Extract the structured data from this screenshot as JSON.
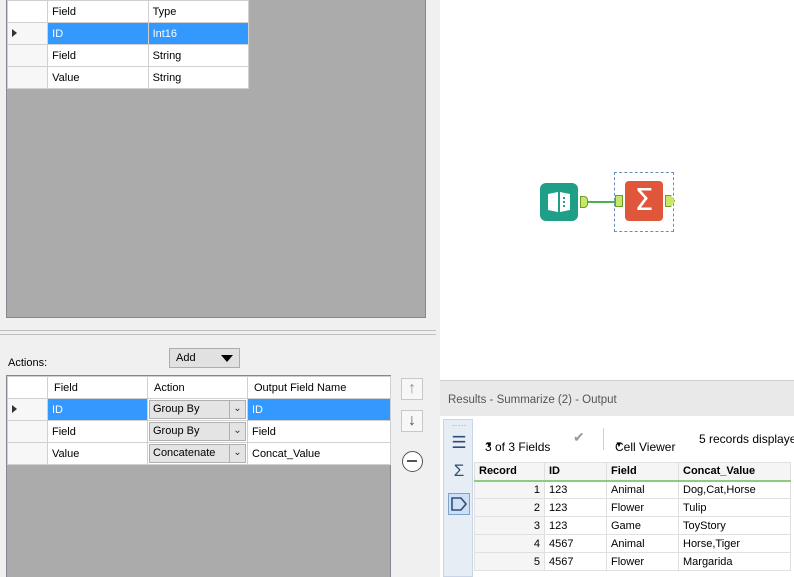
{
  "fields_table": {
    "headers": [
      "Field",
      "Type"
    ],
    "rows": [
      {
        "field": "ID",
        "type": "Int16"
      },
      {
        "field": "Field",
        "type": "String"
      },
      {
        "field": "Value",
        "type": "String"
      }
    ]
  },
  "actions": {
    "label": "Actions:",
    "add_label": "Add",
    "headers": [
      "Field",
      "Action",
      "Output Field Name"
    ],
    "rows": [
      {
        "field": "ID",
        "action": "Group By",
        "output": "ID"
      },
      {
        "field": "Field",
        "action": "Group By",
        "output": "Field"
      },
      {
        "field": "Value",
        "action": "Concatenate",
        "output": "Concat_Value"
      }
    ]
  },
  "canvas": {
    "summarize_glyph": "Σ"
  },
  "results": {
    "title": "Results - Summarize (2) - Output",
    "fields_selector": "3 of 3 Fields",
    "cell_viewer": "Cell Viewer",
    "records_displayed": "5 records displaye",
    "headers": [
      "Record",
      "ID",
      "Field",
      "Concat_Value"
    ],
    "rows": [
      {
        "record": "1",
        "id": "123",
        "field": "Animal",
        "concat": "Dog,Cat,Horse"
      },
      {
        "record": "2",
        "id": "123",
        "field": "Flower",
        "concat": "Tulip"
      },
      {
        "record": "3",
        "id": "123",
        "field": "Game",
        "concat": "ToyStory"
      },
      {
        "record": "4",
        "id": "4567",
        "field": "Animal",
        "concat": "Horse,Tiger"
      },
      {
        "record": "5",
        "id": "4567",
        "field": "Flower",
        "concat": "Margarida"
      }
    ]
  },
  "icons": [
    "row-indicator-icon",
    "dropdown-caret-icon",
    "move-up-icon",
    "move-down-icon",
    "remove-icon",
    "input-data-tool-icon",
    "summarize-tool-icon",
    "table-view-icon",
    "sigma-icon",
    "output-tag-icon",
    "checkmark-icon"
  ],
  "colors": {
    "selection": "#3399ff",
    "input_tool": "#1f9f87",
    "summarize_tool": "#e0563b",
    "connector": "#4caf50"
  }
}
